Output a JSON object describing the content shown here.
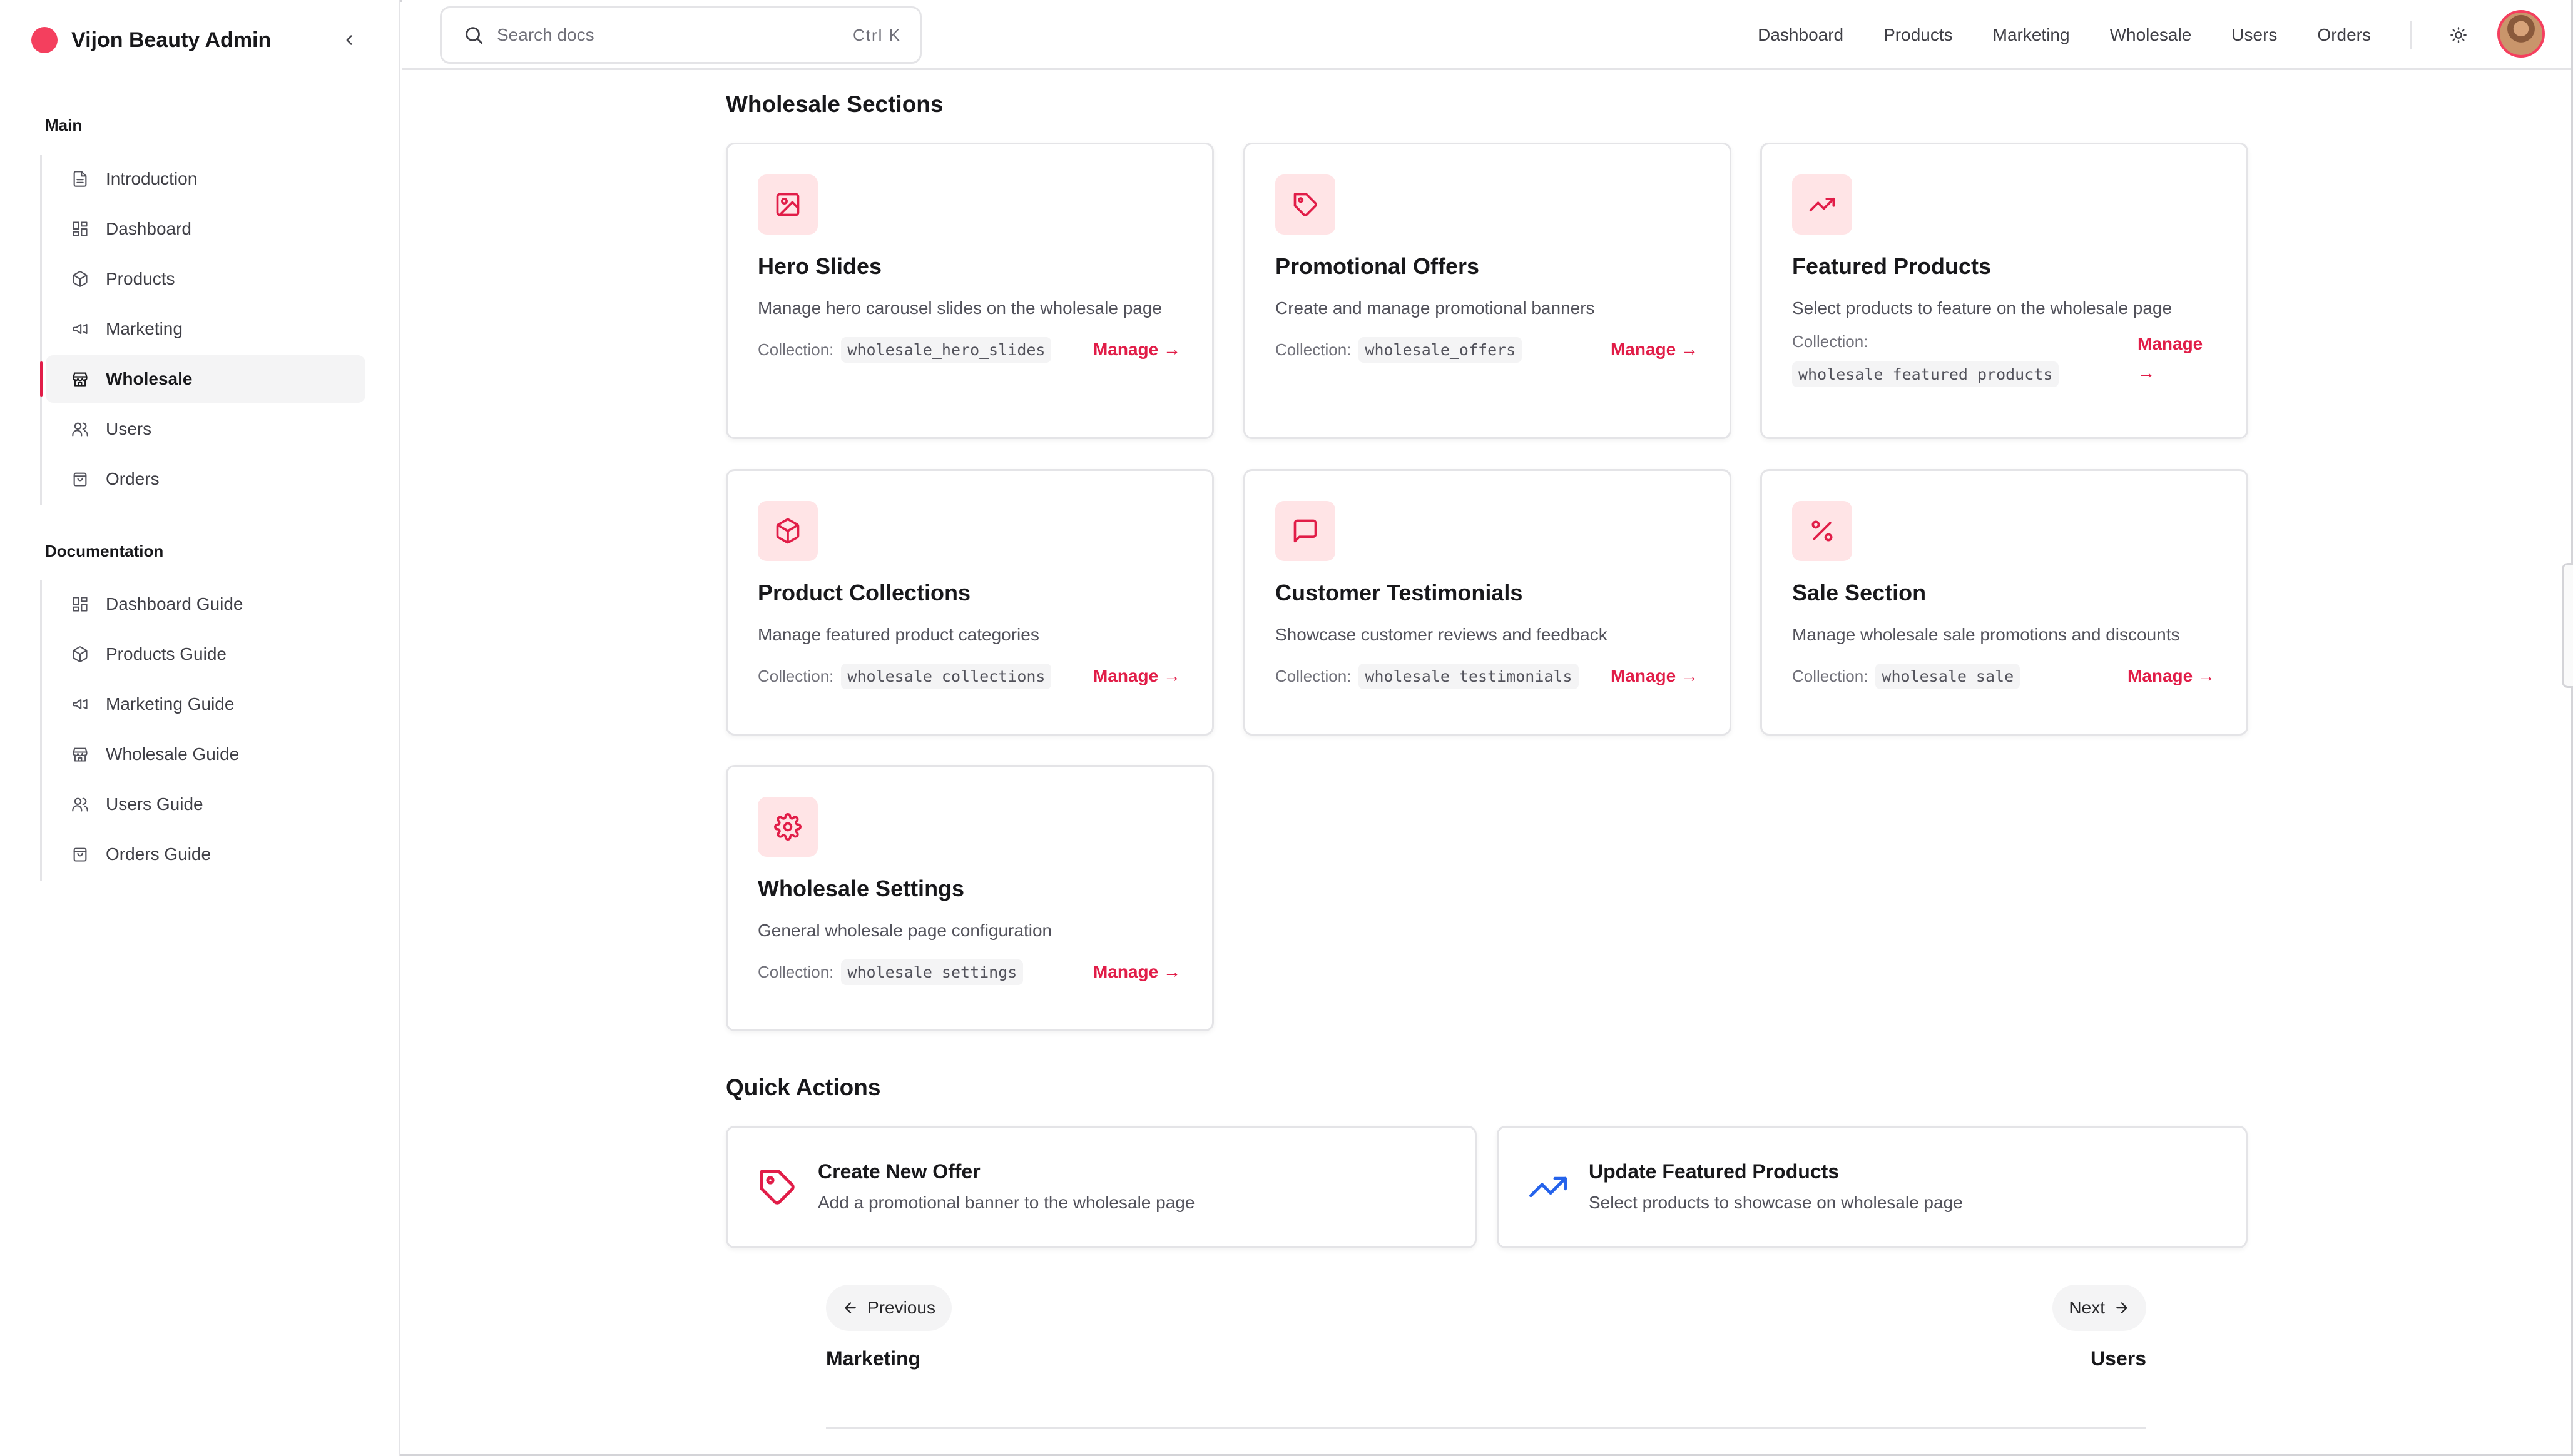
{
  "app": {
    "name": "Vijon Beauty Admin"
  },
  "sidebar": {
    "groups": [
      {
        "label": "Main",
        "items": [
          {
            "label": "Introduction",
            "icon": "file-text-icon"
          },
          {
            "label": "Dashboard",
            "icon": "grid-icon"
          },
          {
            "label": "Products",
            "icon": "package-icon"
          },
          {
            "label": "Marketing",
            "icon": "megaphone-icon"
          },
          {
            "label": "Wholesale",
            "icon": "store-icon",
            "active": true
          },
          {
            "label": "Users",
            "icon": "users-icon"
          },
          {
            "label": "Orders",
            "icon": "shopping-bag-icon"
          }
        ]
      },
      {
        "label": "Documentation",
        "items": [
          {
            "label": "Dashboard Guide",
            "icon": "grid-icon"
          },
          {
            "label": "Products Guide",
            "icon": "package-icon"
          },
          {
            "label": "Marketing Guide",
            "icon": "megaphone-icon"
          },
          {
            "label": "Wholesale Guide",
            "icon": "store-icon"
          },
          {
            "label": "Users Guide",
            "icon": "users-icon"
          },
          {
            "label": "Orders Guide",
            "icon": "shopping-bag-icon"
          }
        ]
      }
    ]
  },
  "search": {
    "placeholder": "Search docs",
    "shortcut": "Ctrl K"
  },
  "topnav": [
    "Dashboard",
    "Products",
    "Marketing",
    "Wholesale",
    "Users",
    "Orders"
  ],
  "sections": {
    "title": "Wholesale Sections",
    "collection_label": "Collection:",
    "manage_label": "Manage →",
    "cards": [
      {
        "title": "Hero Slides",
        "desc": "Manage hero carousel slides on the wholesale page",
        "collection": "wholesale_hero_slides",
        "icon": "image-icon"
      },
      {
        "title": "Promotional Offers",
        "desc": "Create and manage promotional banners",
        "collection": "wholesale_offers",
        "icon": "tag-icon"
      },
      {
        "title": "Featured Products",
        "desc": "Select products to feature on the wholesale page",
        "collection": "wholesale_featured_products",
        "icon": "trending-up-icon"
      },
      {
        "title": "Product Collections",
        "desc": "Manage featured product categories",
        "collection": "wholesale_collections",
        "icon": "package-icon"
      },
      {
        "title": "Customer Testimonials",
        "desc": "Showcase customer reviews and feedback",
        "collection": "wholesale_testimonials",
        "icon": "message-square-icon"
      },
      {
        "title": "Sale Section",
        "desc": "Manage wholesale sale promotions and discounts",
        "collection": "wholesale_sale",
        "icon": "percent-icon"
      },
      {
        "title": "Wholesale Settings",
        "desc": "General wholesale page configuration",
        "collection": "wholesale_settings",
        "icon": "settings-icon"
      }
    ]
  },
  "quick_actions": {
    "title": "Quick Actions",
    "items": [
      {
        "title": "Create New Offer",
        "desc": "Add a promotional banner to the wholesale page",
        "icon": "tag-icon"
      },
      {
        "title": "Update Featured Products",
        "desc": "Select products to showcase on wholesale page",
        "icon": "trending-up-icon"
      }
    ]
  },
  "pager": {
    "prev_label": "Previous",
    "prev_page": "Marketing",
    "next_label": "Next",
    "next_page": "Users"
  },
  "colors": {
    "accent": "#e11d48",
    "accent_soft": "#ffe4e6",
    "blue": "#2563eb"
  }
}
